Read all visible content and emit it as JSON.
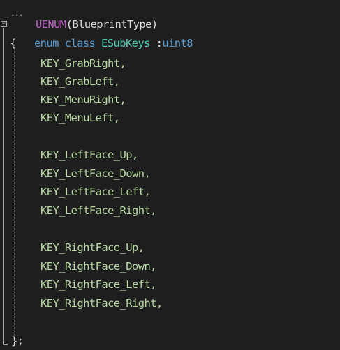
{
  "code": {
    "macro_line": {
      "macro": "UENUM",
      "args": "(BlueprintType)"
    },
    "decl_line": {
      "kw_enum": "enum",
      "kw_class": "class",
      "name": "ESubKeys",
      "colon": " :",
      "underlying": "uint8"
    },
    "open_brace": "{",
    "enum_values": [
      "KEY_GrabRight,",
      "KEY_GrabLeft,",
      "KEY_MenuRight,",
      "KEY_MenuLeft,",
      "KEY_LeftFace_Up,",
      "KEY_LeftFace_Down,",
      "KEY_LeftFace_Left,",
      "KEY_LeftFace_Right,",
      "KEY_RightFace_Up,",
      "KEY_RightFace_Down,",
      "KEY_RightFace_Left,",
      "KEY_RightFace_Right,"
    ],
    "close_brace": "};"
  },
  "theme": {
    "background": "#1e1e1e",
    "macro_color": "#bd63c5",
    "keyword_color": "#569cd6",
    "type_color": "#4ec9b0",
    "enum_value_color": "#b8d7a3",
    "punctuation_color": "#dcdcdc"
  },
  "icons": {
    "fold_toggle": "collapse-minus-icon"
  }
}
